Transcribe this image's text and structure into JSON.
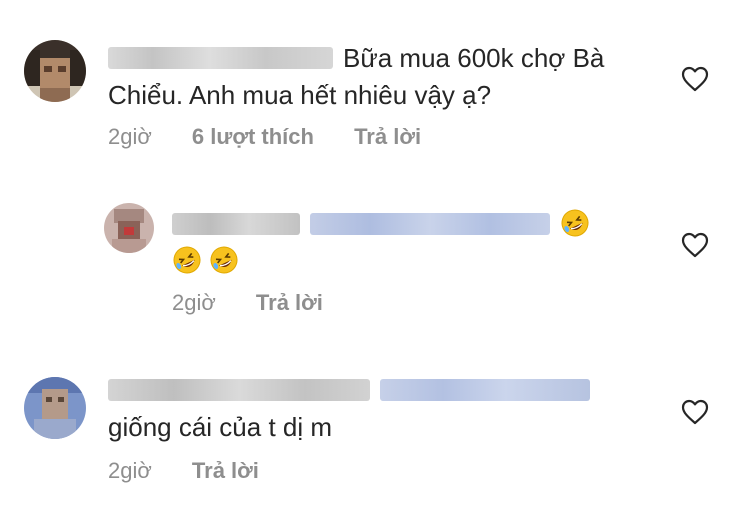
{
  "comments": [
    {
      "text": "Bữa mua 600k chợ Bà Chiểu. Anh mua hết nhiêu vậy ạ?",
      "time": "2giờ",
      "likes": "6 lượt thích",
      "reply": "Trả lời"
    },
    {
      "text": "",
      "time": "2giờ",
      "reply": "Trả lời"
    },
    {
      "text": "giống cái của t dị m",
      "time": "2giờ",
      "reply": "Trả lời"
    }
  ],
  "icons": {
    "like": "heart-outline-icon",
    "emoji": "rolling-on-the-floor-laughing-emoji"
  },
  "colors": {
    "text": "#262626",
    "meta": "#8e8e8e",
    "mention_blur": "#b6c3e0",
    "emoji_face": "#f7c21e"
  }
}
